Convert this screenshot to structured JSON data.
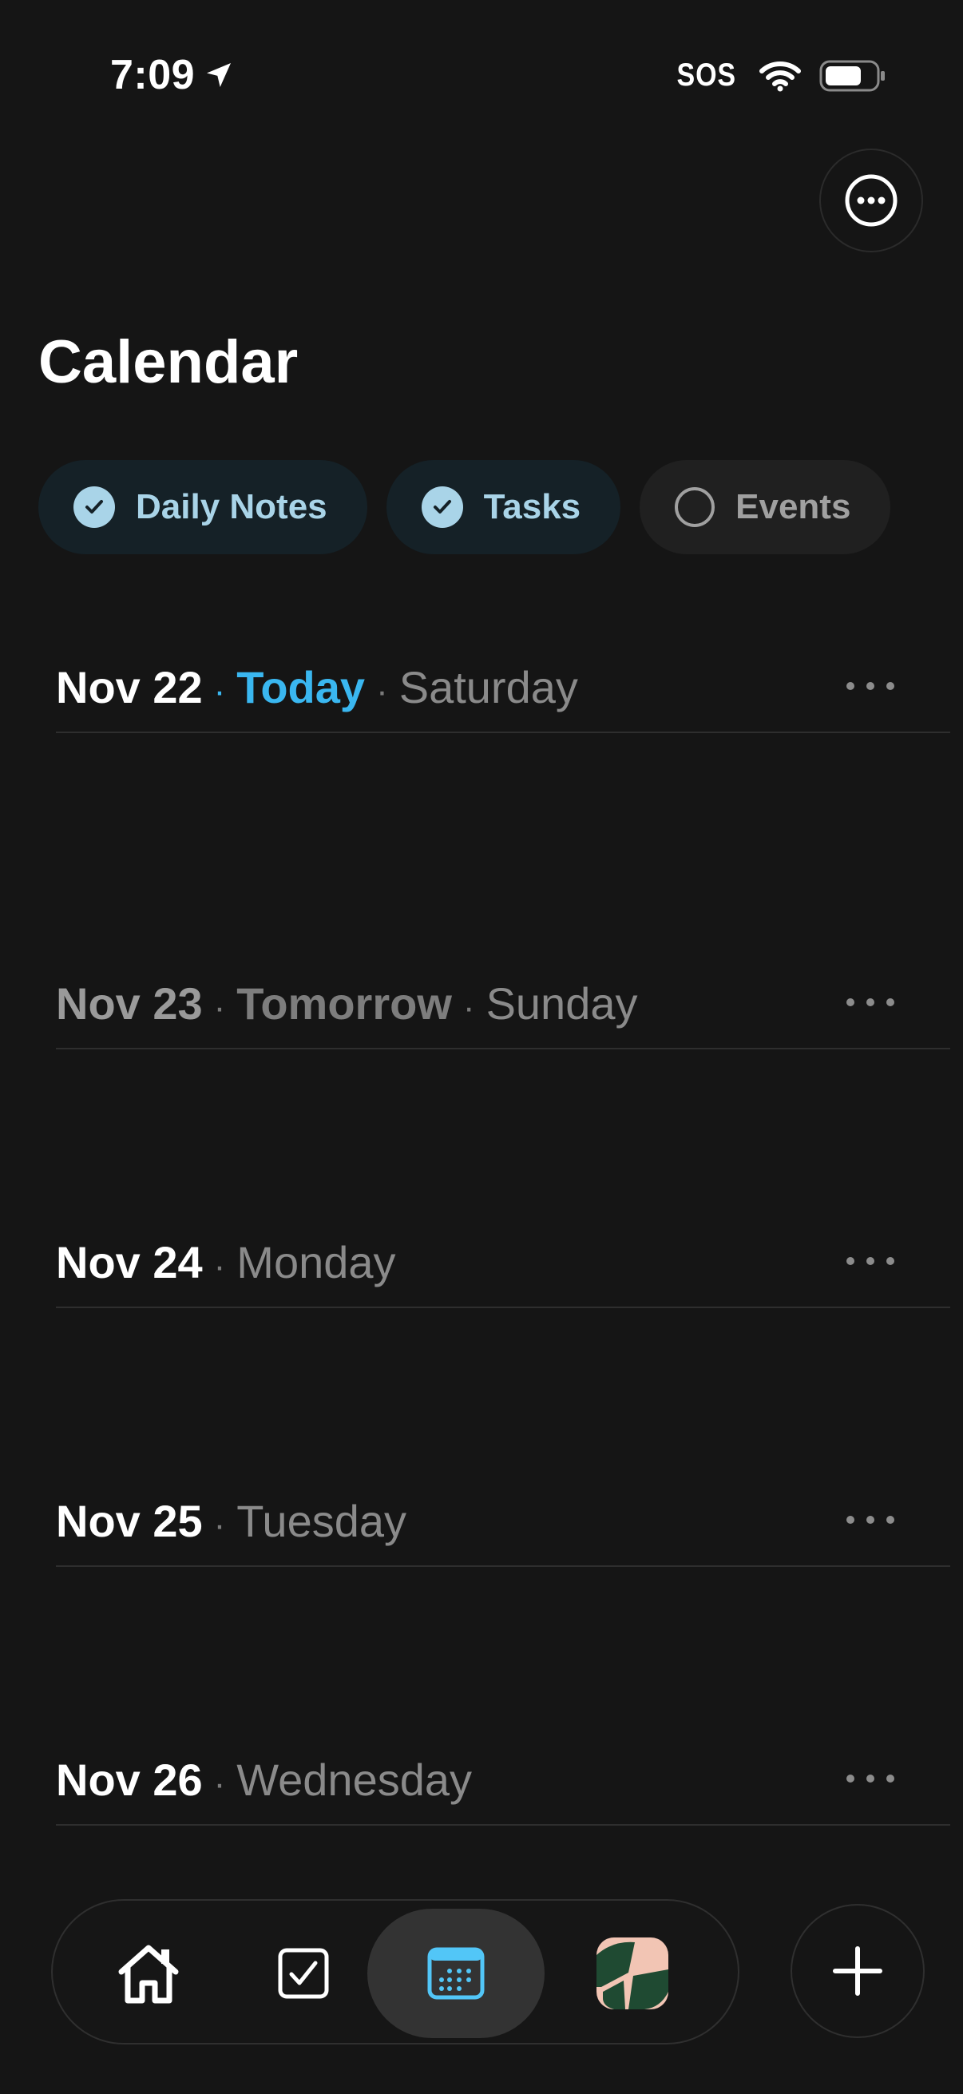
{
  "status_bar": {
    "time": "7:09",
    "sos": "SOS"
  },
  "header": {
    "title": "Calendar"
  },
  "filters": [
    {
      "label": "Daily Notes",
      "checked": true
    },
    {
      "label": "Tasks",
      "checked": true
    },
    {
      "label": "Events",
      "checked": false
    }
  ],
  "days": [
    {
      "date": "Nov 22",
      "relative": "Today",
      "weekday": "Saturday"
    },
    {
      "date": "Nov 23",
      "relative": "Tomorrow",
      "weekday": "Sunday"
    },
    {
      "date": "Nov 24",
      "relative": "",
      "weekday": "Monday"
    },
    {
      "date": "Nov 25",
      "relative": "",
      "weekday": "Tuesday"
    },
    {
      "date": "Nov 26",
      "relative": "",
      "weekday": "Wednesday"
    }
  ],
  "icons": {
    "more": "more-horizontal-circle-icon",
    "home": "home-icon",
    "tasks": "checkbox-icon",
    "calendar": "calendar-icon",
    "avatar": "space-avatar",
    "add": "plus-icon"
  },
  "colors": {
    "accent": "#3ab7f0",
    "chip_active_bg": "#152127",
    "chip_active_fg": "#a9d4e8",
    "background": "#151515"
  }
}
